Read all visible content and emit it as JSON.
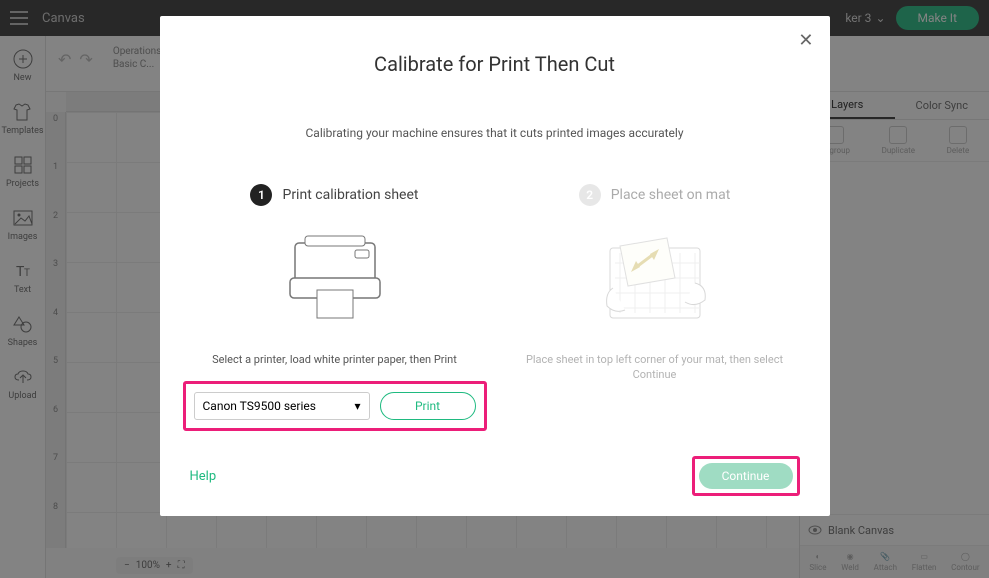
{
  "topbar": {
    "title": "Canvas",
    "device": "ker 3",
    "make_it": "Make It"
  },
  "leftbar": {
    "items": [
      {
        "label": "New"
      },
      {
        "label": "Templates"
      },
      {
        "label": "Projects"
      },
      {
        "label": "Images"
      },
      {
        "label": "Text"
      },
      {
        "label": "Shapes"
      },
      {
        "label": "Upload"
      }
    ]
  },
  "sub_toolbar": {
    "op_label": "Operations",
    "op_value": "Basic C..."
  },
  "ruler_v": [
    "0",
    "1",
    "2",
    "3",
    "4",
    "5",
    "6",
    "7",
    "8"
  ],
  "rightpanel": {
    "tabs": {
      "layers": "Layers",
      "colorsync": "Color Sync"
    },
    "tools": [
      {
        "l": "Ungroup"
      },
      {
        "l": "Duplicate"
      },
      {
        "l": "Delete"
      }
    ],
    "blank": "Blank Canvas",
    "footer": [
      {
        "l": "Slice"
      },
      {
        "l": "Weld"
      },
      {
        "l": "Attach"
      },
      {
        "l": "Flatten"
      },
      {
        "l": "Contour"
      }
    ]
  },
  "zoom": {
    "value": "100%"
  },
  "modal": {
    "title": "Calibrate for Print Then Cut",
    "subtitle": "Calibrating your machine ensures that it cuts printed images accurately",
    "step1": {
      "num": "1",
      "label": "Print calibration sheet",
      "desc": "Select a printer, load white printer paper, then Print",
      "printer": "Canon TS9500 series",
      "print_btn": "Print"
    },
    "step2": {
      "num": "2",
      "label": "Place sheet on mat",
      "desc": "Place sheet in top left corner of your mat, then select Continue"
    },
    "help": "Help",
    "continue": "Continue"
  }
}
